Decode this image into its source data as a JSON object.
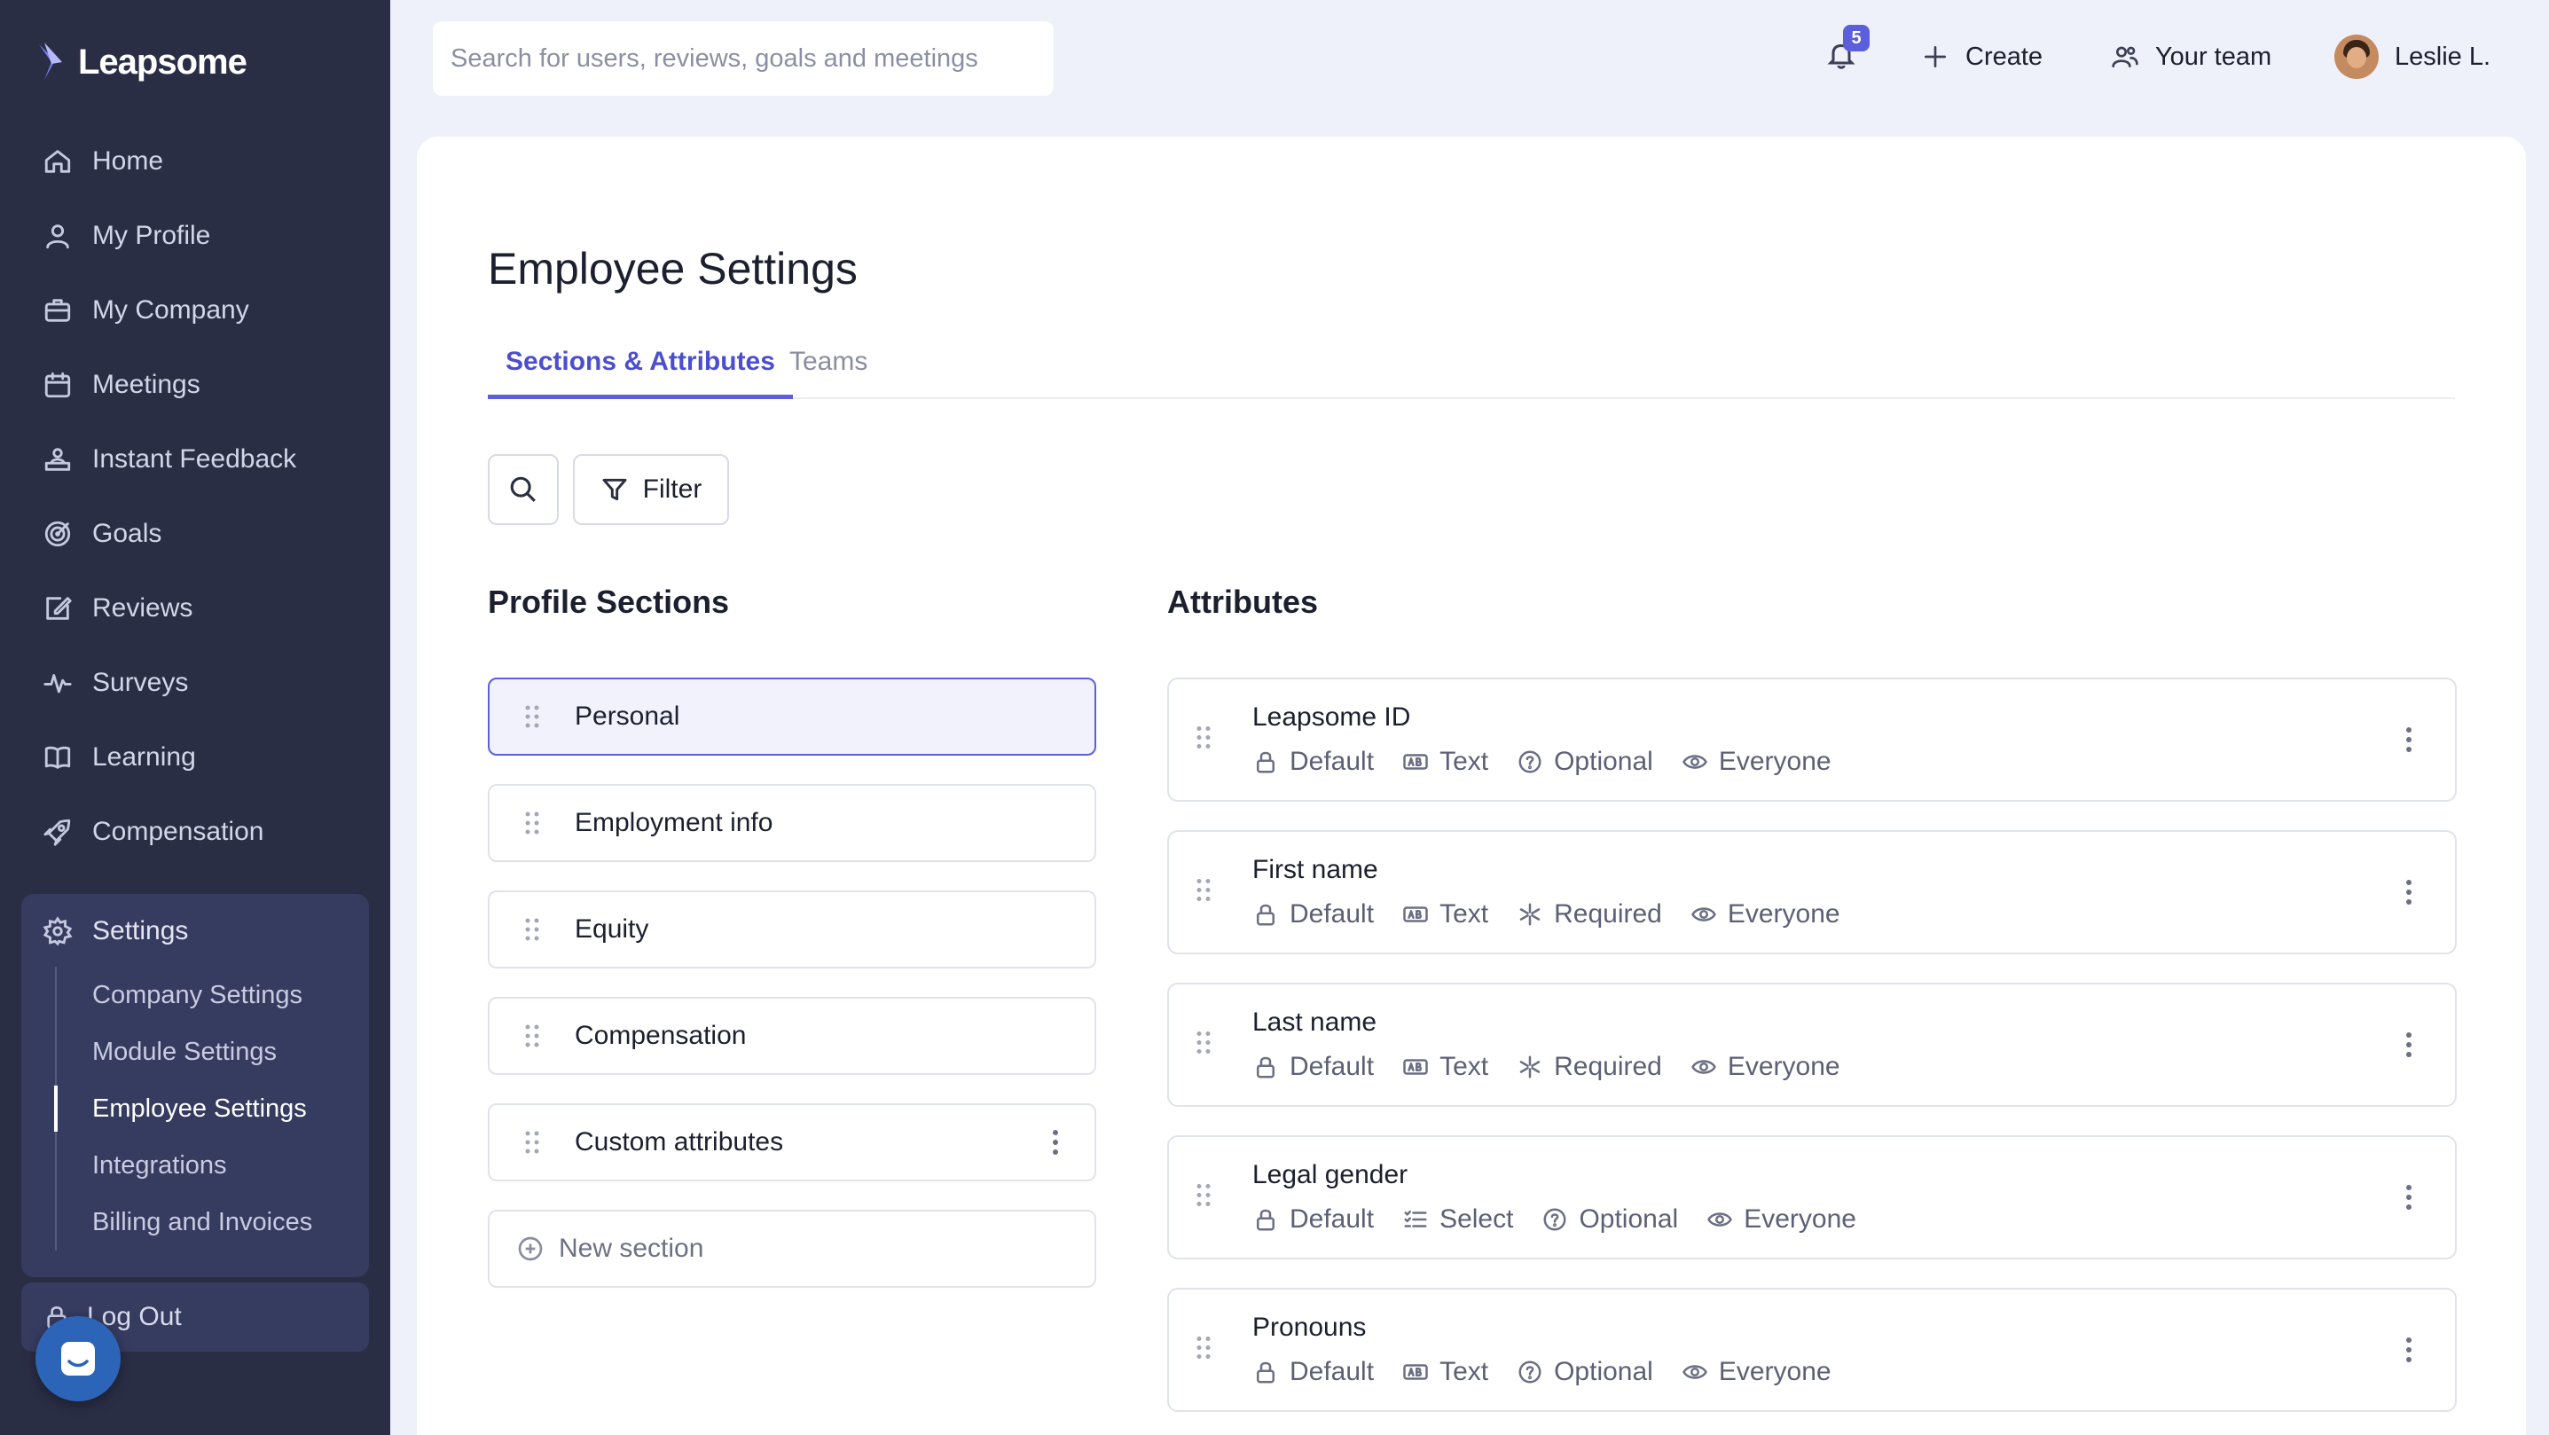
{
  "app": {
    "name": "Leapsome"
  },
  "nav": {
    "items": [
      {
        "label": "Home",
        "icon": "home-icon"
      },
      {
        "label": "My Profile",
        "icon": "user-icon"
      },
      {
        "label": "My Company",
        "icon": "briefcase-icon"
      },
      {
        "label": "Meetings",
        "icon": "calendar-icon"
      },
      {
        "label": "Instant Feedback",
        "icon": "feedback-icon"
      },
      {
        "label": "Goals",
        "icon": "target-icon"
      },
      {
        "label": "Reviews",
        "icon": "edit-icon"
      },
      {
        "label": "Surveys",
        "icon": "pulse-icon"
      },
      {
        "label": "Learning",
        "icon": "book-icon"
      },
      {
        "label": "Compensation",
        "icon": "rocket-icon"
      }
    ],
    "settings": {
      "label": "Settings",
      "items": [
        "Company Settings",
        "Module Settings",
        "Employee Settings",
        "Integrations",
        "Billing and Invoices"
      ],
      "active": "Employee Settings"
    },
    "logout": "Log Out"
  },
  "topbar": {
    "search_placeholder": "Search for users, reviews, goals and meetings",
    "notification_count": "5",
    "create_label": "Create",
    "team_label": "Your team",
    "user_name": "Leslie L."
  },
  "page": {
    "title": "Employee Settings",
    "tabs": [
      "Sections & Attributes",
      "Teams"
    ],
    "active_tab": "Sections & Attributes",
    "filter_label": "Filter"
  },
  "profile_sections": {
    "title": "Profile Sections",
    "items": [
      "Personal",
      "Employment info",
      "Equity",
      "Compensation",
      "Custom attributes"
    ],
    "selected": "Personal",
    "new_label": "New section"
  },
  "attributes": {
    "title": "Attributes",
    "items": [
      {
        "name": "Leapsome ID",
        "source": "Default",
        "type": "Text",
        "requirement": "Optional",
        "visibility": "Everyone"
      },
      {
        "name": "First name",
        "source": "Default",
        "type": "Text",
        "requirement": "Required",
        "visibility": "Everyone"
      },
      {
        "name": "Last name",
        "source": "Default",
        "type": "Text",
        "requirement": "Required",
        "visibility": "Everyone"
      },
      {
        "name": "Legal gender",
        "source": "Default",
        "type": "Select",
        "requirement": "Optional",
        "visibility": "Everyone"
      },
      {
        "name": "Pronouns",
        "source": "Default",
        "type": "Text",
        "requirement": "Optional",
        "visibility": "Everyone"
      }
    ]
  },
  "colors": {
    "sidebar_bg": "#2a2e45",
    "accent": "#5b5fdc",
    "page_bg": "#eef0fa"
  }
}
